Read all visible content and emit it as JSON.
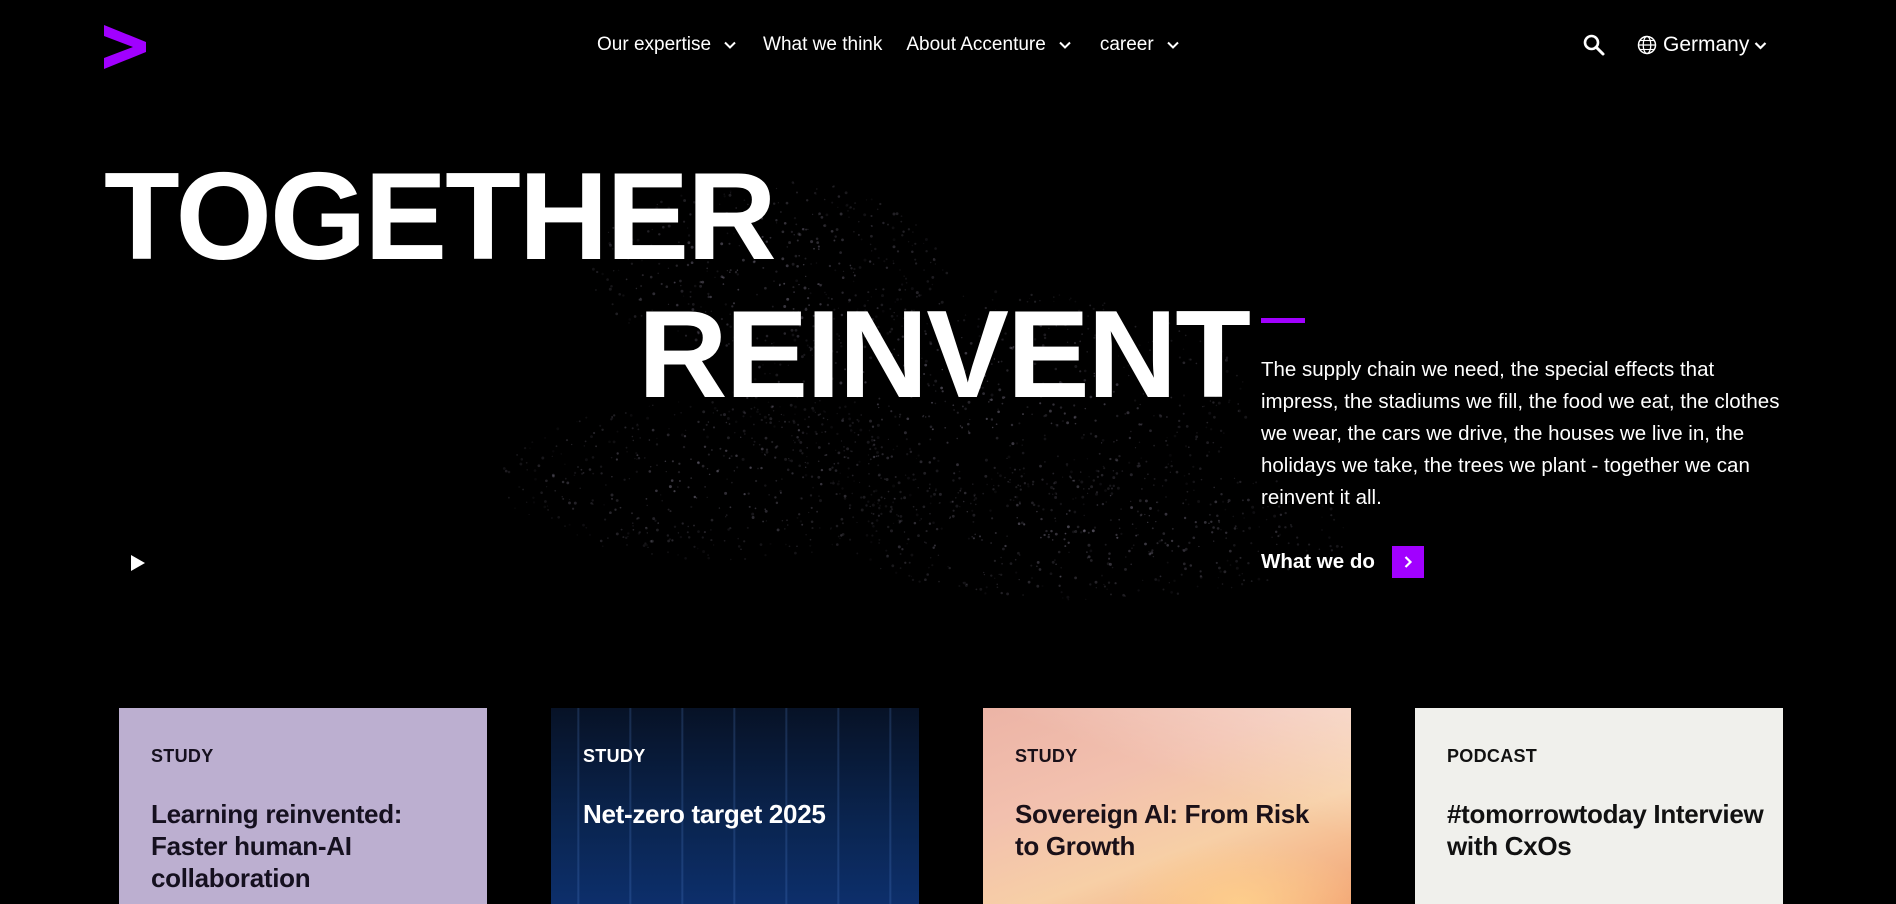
{
  "brand": {
    "logo_icon": "accenture-greater-than-logo",
    "accent_color": "#a100ff",
    "background_color": "#000000"
  },
  "nav": {
    "items": [
      {
        "label": "Our expertise",
        "has_dropdown": true
      },
      {
        "label": "What we think",
        "has_dropdown": false
      },
      {
        "label": "About Accenture",
        "has_dropdown": true
      },
      {
        "label": "career",
        "has_dropdown": true
      }
    ],
    "search_icon": "search-icon",
    "locale": {
      "label": "Germany",
      "icon": "globe-icon"
    }
  },
  "hero": {
    "headline_line1": "TOGETHER",
    "headline_line2": "REINVENT",
    "body": "The supply chain we need, the special effects that impress, the stadiums we fill, the food we eat, the clothes we wear, the cars we drive, the houses we live in, the holidays we take, the trees we plant - together we can reinvent it all.",
    "cta_label": "What we do",
    "cta_icon": "chevron-right-icon",
    "video_control_icon": "play-icon"
  },
  "cards": [
    {
      "type": "STUDY",
      "title": "Learning reinvented: Faster human-AI collaboration",
      "background": "#bcafd0"
    },
    {
      "type": "STUDY",
      "title": "Net-zero target 2025",
      "background": "#0a2551"
    },
    {
      "type": "STUDY",
      "title": "Sovereign AI: From Risk to Growth",
      "background": "#f2c0ae"
    },
    {
      "type": "PODCAST",
      "title": "#tomorrowtoday Interview with CxOs",
      "background": "#f0f0ec"
    }
  ]
}
